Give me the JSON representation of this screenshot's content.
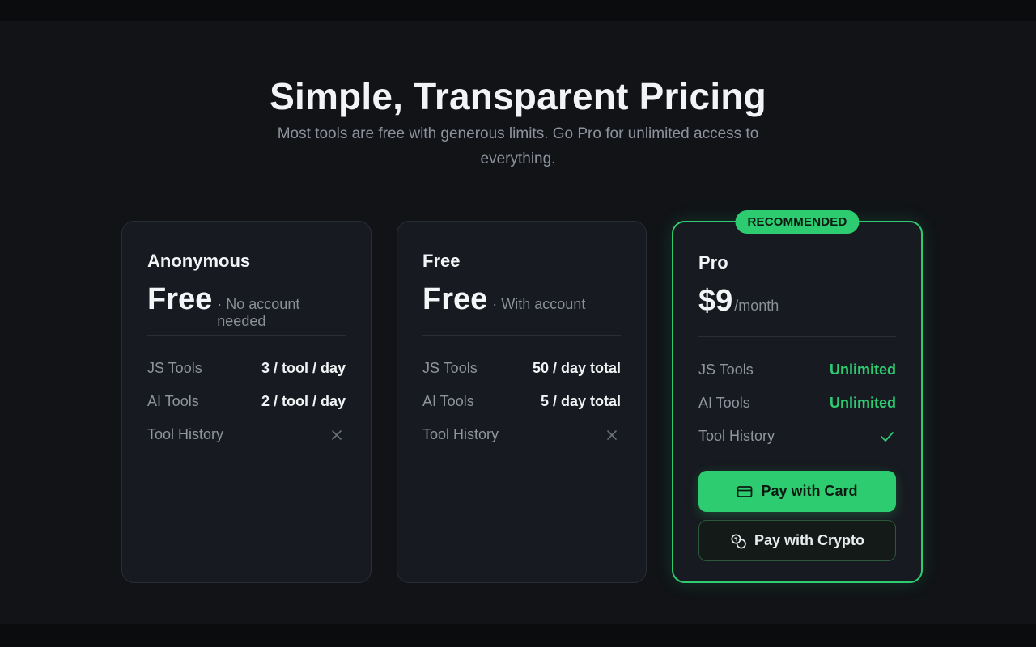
{
  "hero": {
    "title": "Simple, Transparent Pricing",
    "subtitle": "Most tools are free with generous limits. Go Pro for unlimited access to everything."
  },
  "plans": [
    {
      "name": "Anonymous",
      "price": "Free",
      "note": "· No account needed",
      "features": [
        {
          "label": "JS Tools",
          "value": "3 / tool / day"
        },
        {
          "label": "AI Tools",
          "value": "2 / tool / day"
        },
        {
          "label": "Tool History",
          "icon": "x-icon"
        }
      ]
    },
    {
      "name": "Free",
      "price": "Free",
      "note": "· With account",
      "features": [
        {
          "label": "JS Tools",
          "value": "50 / day total"
        },
        {
          "label": "AI Tools",
          "value": "5 / day total"
        },
        {
          "label": "Tool History",
          "icon": "x-icon"
        }
      ]
    },
    {
      "name": "Pro",
      "badge": "RECOMMENDED",
      "price": "$9",
      "note": "/month",
      "features": [
        {
          "label": "JS Tools",
          "value": "Unlimited"
        },
        {
          "label": "AI Tools",
          "value": "Unlimited"
        },
        {
          "label": "Tool History",
          "icon": "check-icon"
        }
      ],
      "buttons": {
        "card": {
          "label": "Pay with Card",
          "icon": "credit-card-icon"
        },
        "crypto": {
          "label": "Pay with Crypto",
          "icon": "coins-icon"
        }
      }
    }
  ],
  "colors": {
    "accent": "#2ecc71",
    "background": "#111317",
    "card": "#171a20",
    "muted_text": "#8f959f"
  }
}
